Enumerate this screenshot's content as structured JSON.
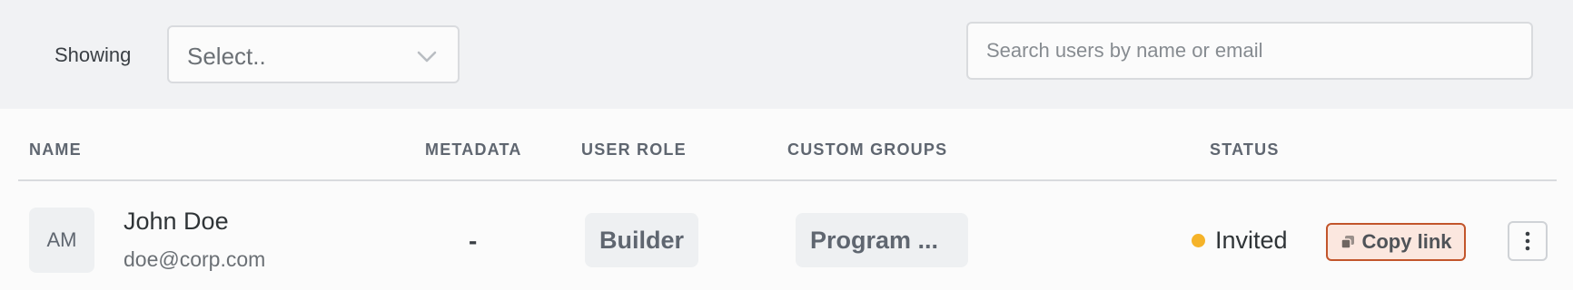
{
  "filters": {
    "showing_label": "Showing",
    "select_value": "Select..",
    "select_icon": "chevron-down-icon",
    "search_placeholder": "Search users by name or email",
    "search_value": ""
  },
  "table": {
    "columns": {
      "name": "NAME",
      "metadata": "METADATA",
      "role": "USER ROLE",
      "groups": "CUSTOM GROUPS",
      "status": "STATUS"
    },
    "rows": [
      {
        "avatar_initials": "AM",
        "name": "John Doe",
        "email": "doe@corp.com",
        "metadata": "-",
        "role": "Builder",
        "groups": "Program ...",
        "status": "Invited",
        "status_color": "#f5b329",
        "copy_link_label": "Copy link",
        "copy_icon": "copy-icon",
        "more_icon": "more-vertical-icon"
      }
    ]
  },
  "colors": {
    "topbar_bg": "#f1f2f4",
    "page_bg": "#fbfbfb",
    "copy_link_border": "#c2552b",
    "copy_link_bg": "#fbe7df"
  }
}
